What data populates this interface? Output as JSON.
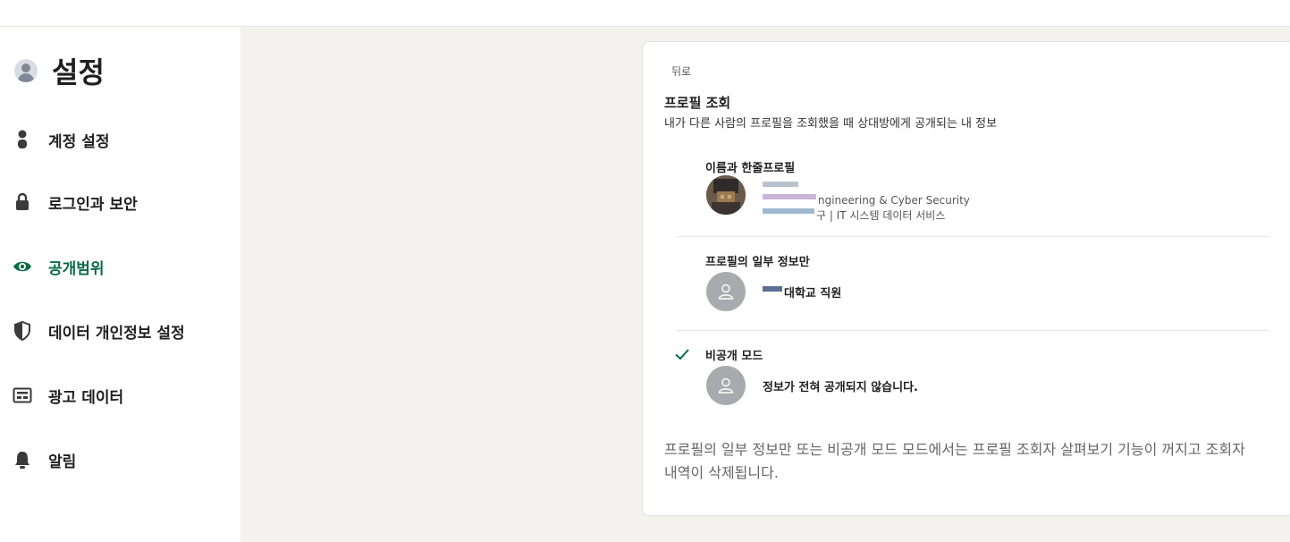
{
  "sidebar": {
    "title": "설정",
    "items": [
      {
        "label": "계정 설정",
        "icon": "person-icon"
      },
      {
        "label": "로그인과 보안",
        "icon": "lock-icon"
      },
      {
        "label": "공개범위",
        "icon": "eye-icon",
        "active": true
      },
      {
        "label": "데이터 개인정보 설정",
        "icon": "shield-icon"
      },
      {
        "label": "광고 데이터",
        "icon": "ad-icon"
      },
      {
        "label": "알림",
        "icon": "bell-icon"
      }
    ]
  },
  "panel": {
    "back": "뒤로",
    "title": "프로필 조회",
    "subtitle": "내가 다른 사람의 프로필을 조회했을 때 상대방에게 공개되는 내 정보",
    "options": [
      {
        "label": "이름과 한줄프로필",
        "line1": "ngineering & Cyber Security",
        "line2": "구 | IT 시스템 데이터 서비스",
        "selected": false
      },
      {
        "label": "프로필의 일부 정보만",
        "text": "대학교 직원",
        "selected": false
      },
      {
        "label": "비공개 모드",
        "text": "정보가 전혀 공개되지 않습니다.",
        "selected": true
      }
    ],
    "footnote": "프로필의 일부 정보만 또는 비공개 모드 모드에서는 프로필 조회자 살펴보기 기능이 꺼지고 조회자 내역이 삭제됩니다."
  },
  "colors": {
    "accent": "#0a6b45",
    "background": "#f4f2ee"
  }
}
